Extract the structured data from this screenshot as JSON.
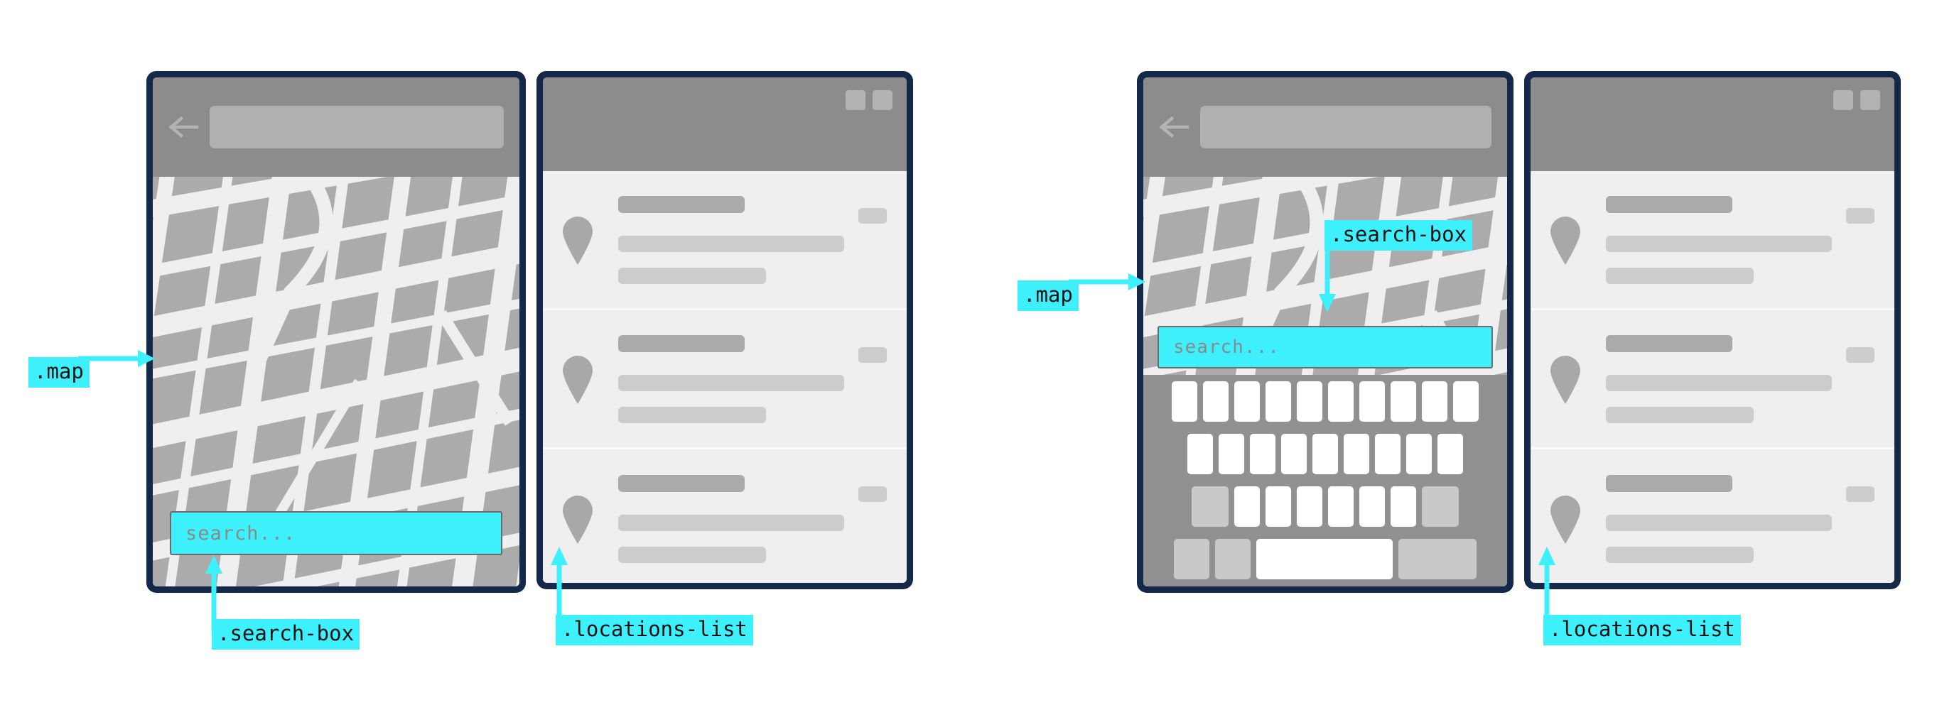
{
  "diagram": {
    "title": "Map search UI wireframe annotation",
    "accent_color": "#3ef0fb",
    "frame_color": "#14294a",
    "appbar_color": "#8c8c8c",
    "map_background": "#ababab",
    "map_road_color": "#efefef",
    "list_background": "#efefef",
    "keyboard_background": "#919191"
  },
  "panels": {
    "left_map_phone": {
      "name": "map-phone-closed-keyboard",
      "appbar": {
        "back_icon": "back-arrow-icon",
        "field_placeholder": ""
      },
      "search_box": {
        "value": "",
        "placeholder": "search...",
        "highlighted": true
      }
    },
    "left_list_panel": {
      "name": "locations-list-panel",
      "header_buttons": [
        "header-button-1",
        "header-button-2"
      ],
      "rows": [
        {
          "icon": "map-pin-icon",
          "title": "",
          "line1": "",
          "line2": "",
          "badge": ""
        },
        {
          "icon": "map-pin-icon",
          "title": "",
          "line1": "",
          "line2": "",
          "badge": ""
        },
        {
          "icon": "map-pin-icon",
          "title": "",
          "line1": "",
          "line2": "",
          "badge": ""
        }
      ]
    },
    "right_map_phone": {
      "name": "map-phone-open-keyboard",
      "appbar": {
        "back_icon": "back-arrow-icon",
        "field_placeholder": ""
      },
      "search_box": {
        "value": "",
        "placeholder": "search...",
        "highlighted": true,
        "focused": true
      },
      "keyboard": {
        "visible": true,
        "rows": [
          {
            "keys": 10,
            "type": "letters"
          },
          {
            "keys": 9,
            "type": "letters"
          },
          {
            "keys": 8,
            "type": "letters-with-modifiers"
          },
          {
            "keys": 4,
            "type": "bottom-row-with-spacebar"
          }
        ]
      }
    },
    "right_list_panel": {
      "name": "locations-list-panel",
      "header_buttons": [
        "header-button-1",
        "header-button-2"
      ],
      "rows": [
        {
          "icon": "map-pin-icon",
          "title": "",
          "line1": "",
          "line2": "",
          "badge": ""
        },
        {
          "icon": "map-pin-icon",
          "title": "",
          "line1": "",
          "line2": "",
          "badge": ""
        },
        {
          "icon": "map-pin-icon",
          "title": "",
          "line1": "",
          "line2": "",
          "badge": ""
        }
      ]
    }
  },
  "annotations": {
    "left_map": {
      "label": ".map",
      "points_to": "map-area",
      "direction": "right"
    },
    "left_search_box": {
      "label": ".search-box",
      "points_to": "search-box",
      "direction": "up"
    },
    "left_locations_list": {
      "label": ".locations-list",
      "points_to": "locations-list",
      "direction": "up"
    },
    "right_map": {
      "label": ".map",
      "points_to": "map-area",
      "direction": "right"
    },
    "right_search_box": {
      "label": ".search-box",
      "points_to": "search-box",
      "direction": "down"
    },
    "right_locations_list": {
      "label": ".locations-list",
      "points_to": "locations-list",
      "direction": "up"
    }
  },
  "search_text": {
    "placeholder": "search..."
  }
}
